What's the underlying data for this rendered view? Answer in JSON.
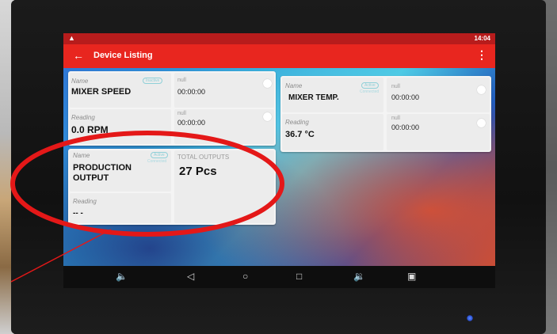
{
  "app_bar": {
    "back_icon": "arrow-left-icon",
    "title": "Device Listing",
    "menu_icon": "more-vert-icon"
  },
  "status_bar": {
    "time": "14:04",
    "icon": "warning-icon"
  },
  "devices": [
    {
      "name_label": "Name",
      "name": "MIXER SPEED",
      "badge": "Inactive",
      "reading_label": "Reading",
      "reading": "0.0 RPM",
      "rows": [
        {
          "label": "null",
          "value": "00:00:00"
        },
        {
          "label": "null",
          "value": "00:00:00"
        }
      ]
    },
    {
      "name_label": "Name",
      "name": "MIXER TEMP.",
      "badge": "Active",
      "status": "Connected",
      "reading_label": "Reading",
      "reading": "36.7 °C",
      "rows": [
        {
          "label": "null",
          "value": "00:00:00"
        },
        {
          "label": "null",
          "value": "00:00:00"
        }
      ]
    },
    {
      "name_label": "Name",
      "name": "PRODUCTION OUTPUT",
      "badge": "Active",
      "status": "Connected",
      "reading_label": "Reading",
      "reading": "-- -",
      "total_label": "TOTAL OUTPUTS",
      "total_value": "27 Pcs"
    }
  ],
  "nav_bar": {
    "icons": [
      "volume-down-icon",
      "back-icon",
      "home-icon",
      "recents-icon",
      "volume-up-icon",
      "screenshot-icon"
    ]
  },
  "colors": {
    "app_bar": "#e8261f",
    "status_bar": "#b71c1c",
    "card": "#f4f4f4",
    "annotation": "#e41818"
  }
}
